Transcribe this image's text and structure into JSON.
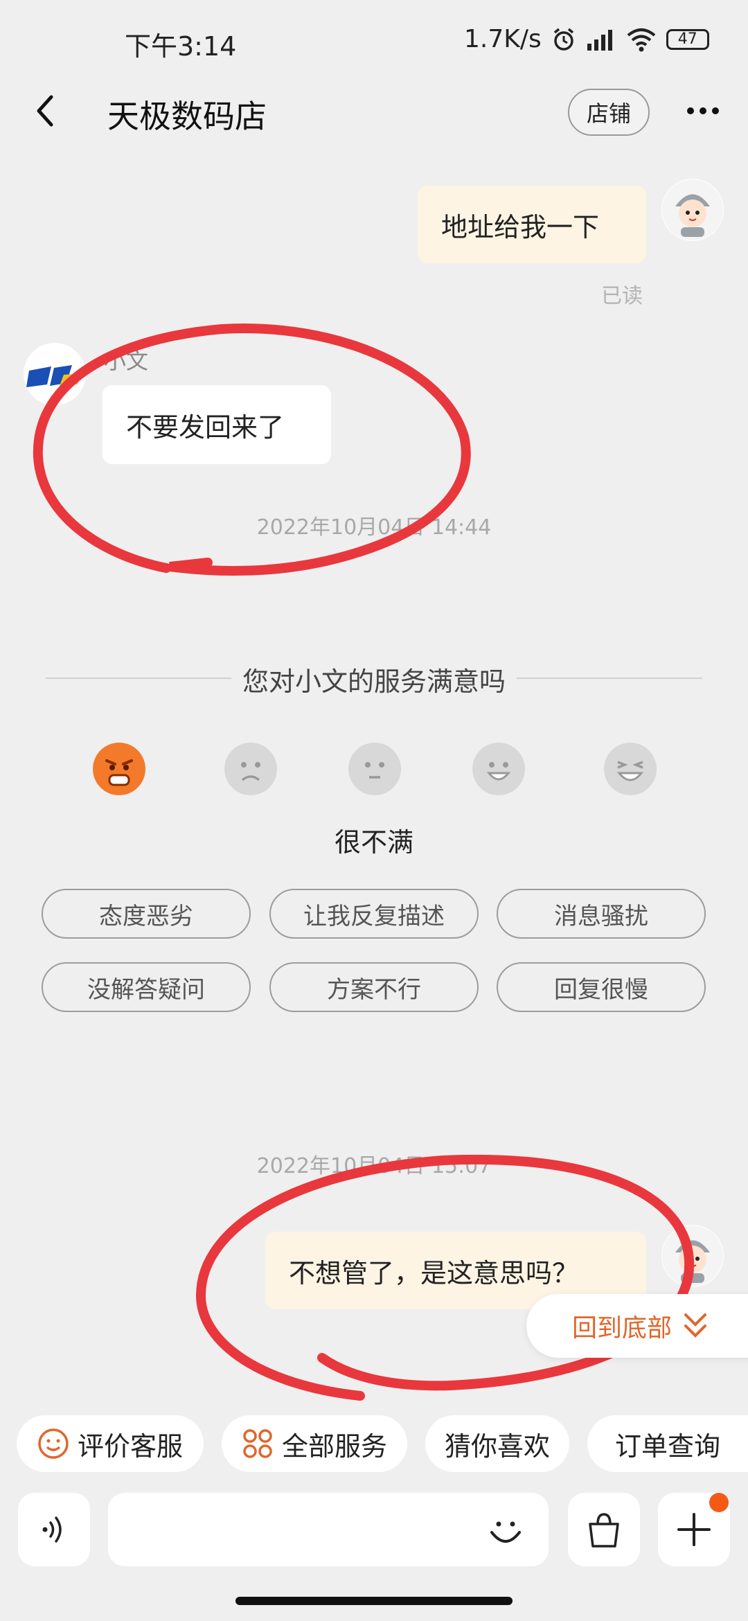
{
  "status_bar": {
    "time": "下午3:14",
    "speed": "1.7K/s",
    "battery": "47"
  },
  "header": {
    "title": "天极数码店",
    "shop_label": "店铺"
  },
  "messages": {
    "me_1": "地址给我一下",
    "read_status": "已读",
    "shop_sender": "小文",
    "shop_1": "不要发回来了",
    "time_1": "2022年10月04日 14:44",
    "time_2": "2022年10月04日 15:07",
    "me_2": "不想管了，是这意思吗？"
  },
  "survey": {
    "title": "您对小文的服务满意吗",
    "selected_rating": 1,
    "rating_label": "很不满",
    "tags": [
      "态度恶劣",
      "让我反复描述",
      "消息骚扰",
      "没解答疑问",
      "方案不行",
      "回复很慢"
    ]
  },
  "scroll_to_bottom": "回到底部",
  "quick_actions": [
    "评价客服",
    "全部服务",
    "猜你喜欢",
    "订单查询"
  ],
  "colors": {
    "accent": "#e0662a",
    "annotation": "#e8383d",
    "bubble_me": "#fdf4e4",
    "notification_dot": "#f45a16"
  }
}
